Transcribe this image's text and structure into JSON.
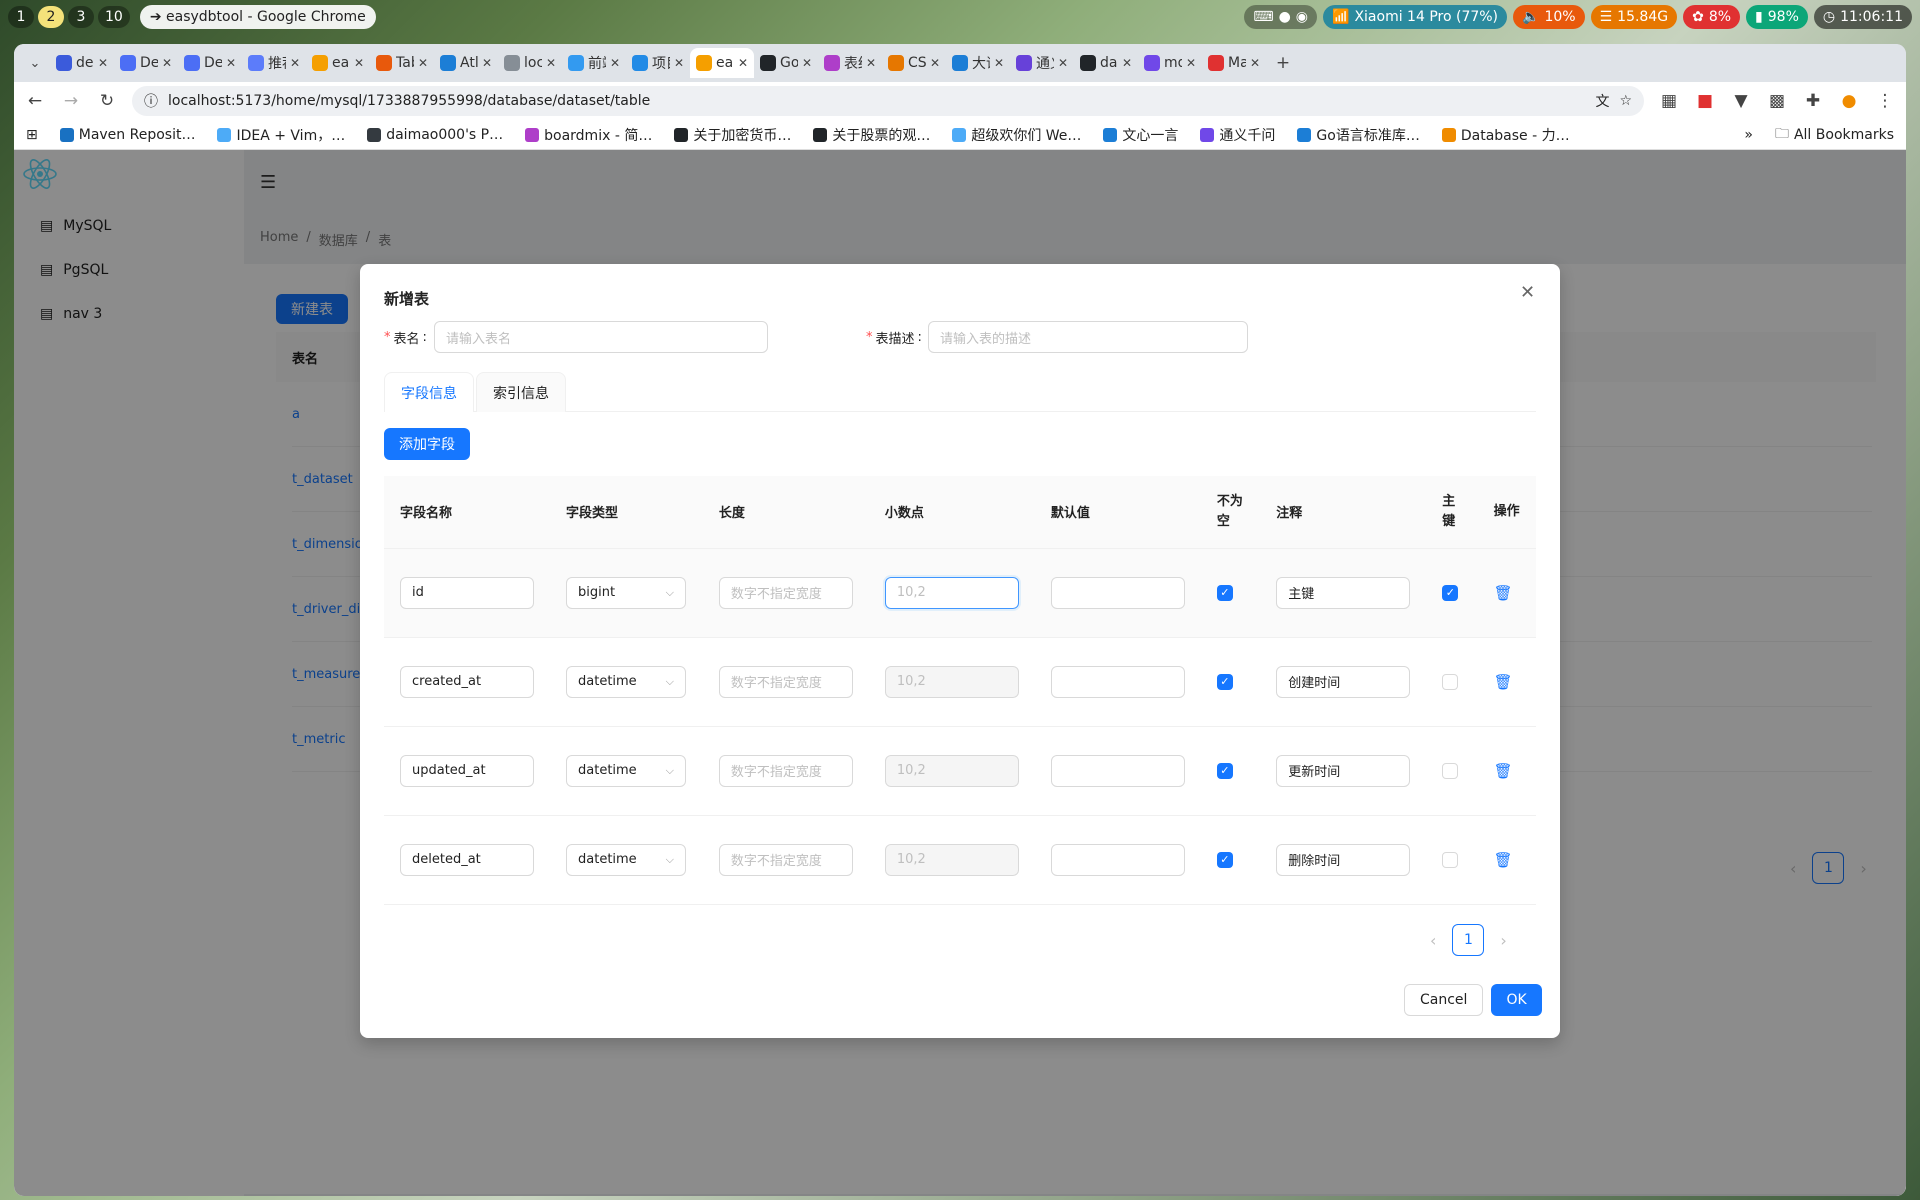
{
  "desktop": {
    "workspaces": [
      "1",
      "2",
      "3",
      "10"
    ],
    "active_workspace": "2",
    "window_title": "easydbtool - Google Chrome",
    "tray": {
      "wifi": "Xiaomi 14 Pro (77%)",
      "volume": "10%",
      "memory": "15.84G",
      "cpu": "8%",
      "battery": "98%",
      "clock": "11:06:11"
    }
  },
  "browser": {
    "tabs": [
      {
        "label": "dee",
        "color": "#3b5bdb"
      },
      {
        "label": "Dee",
        "color": "#4c6ef5"
      },
      {
        "label": "Dee",
        "color": "#4c6ef5"
      },
      {
        "label": "推荐",
        "color": "#5c7cfa"
      },
      {
        "label": "eas",
        "color": "#f59f00"
      },
      {
        "label": "Tab",
        "color": "#e8590c"
      },
      {
        "label": "Atla",
        "color": "#1c7ed6"
      },
      {
        "label": "loca",
        "color": "#868e96"
      },
      {
        "label": "前端",
        "color": "#339af0"
      },
      {
        "label": "项目",
        "color": "#228be6"
      },
      {
        "label": "eas",
        "color": "#f59f00"
      },
      {
        "label": "Go",
        "color": "#212529"
      },
      {
        "label": "表结",
        "color": "#ae3ec9"
      },
      {
        "label": "CSV",
        "color": "#e67700"
      },
      {
        "label": "大语",
        "color": "#1c7ed6"
      },
      {
        "label": "通义",
        "color": "#6741d9"
      },
      {
        "label": "dai",
        "color": "#212529"
      },
      {
        "label": "md",
        "color": "#7048e8"
      },
      {
        "label": "Ma",
        "color": "#e03131"
      }
    ],
    "active_tab_index": 10,
    "url": "localhost:5173/home/mysql/1733887955998/database/dataset/table",
    "bookmarks": [
      {
        "label": "Maven Reposit…",
        "color": "#1971c2"
      },
      {
        "label": "IDEA + Vim，…",
        "color": "#4dabf7"
      },
      {
        "label": "daimao000's P…",
        "color": "#343a40"
      },
      {
        "label": "boardmix - 简…",
        "color": "#ae3ec9"
      },
      {
        "label": "关于加密货币…",
        "color": "#212529"
      },
      {
        "label": "关于股票的观…",
        "color": "#212529"
      },
      {
        "label": "超级欢你们 We…",
        "color": "#4dabf7"
      },
      {
        "label": "文心一言",
        "color": "#1c7ed6"
      },
      {
        "label": "通义千问",
        "color": "#7048e8"
      },
      {
        "label": "Go语言标准库…",
        "color": "#1c7ed6"
      },
      {
        "label": "Database - 力…",
        "color": "#f08c00"
      }
    ],
    "all_bookmarks": "All Bookmarks"
  },
  "sidebar": {
    "items": [
      {
        "label": "MySQL"
      },
      {
        "label": "PgSQL"
      },
      {
        "label": "nav 3"
      }
    ]
  },
  "background_page": {
    "breadcrumb": [
      "Home",
      "数据库",
      "表"
    ],
    "new_table_button": "新建表",
    "table_header": "表名",
    "rows": [
      "a",
      "t_dataset",
      "t_dimension",
      "t_driver_dime",
      "t_measure",
      "t_metric"
    ],
    "page": "1"
  },
  "modal": {
    "title": "新增表",
    "table_name_label": "表名",
    "table_name_placeholder": "请输入表名",
    "table_desc_label": "表描述",
    "table_desc_placeholder": "请输入表的描述",
    "tabs": [
      "字段信息",
      "索引信息"
    ],
    "active_tab": 0,
    "add_field_button": "添加字段",
    "columns": [
      "字段名称",
      "字段类型",
      "长度",
      "小数点",
      "默认值",
      "不为空",
      "注释",
      "主键",
      "操作"
    ],
    "length_placeholder": "数字不指定宽度",
    "decimal_placeholder": "10,2",
    "fields": [
      {
        "name": "id",
        "type": "bigint",
        "not_null": true,
        "comment": "主键",
        "primary": true
      },
      {
        "name": "created_at",
        "type": "datetime",
        "not_null": true,
        "comment": "创建时间",
        "primary": false
      },
      {
        "name": "updated_at",
        "type": "datetime",
        "not_null": true,
        "comment": "更新时间",
        "primary": false
      },
      {
        "name": "deleted_at",
        "type": "datetime",
        "not_null": true,
        "comment": "删除时间",
        "primary": false
      }
    ],
    "page": "1",
    "cancel_button": "Cancel",
    "ok_button": "OK"
  },
  "colors": {
    "primary": "#1677ff",
    "required": "#ff4d4f"
  }
}
